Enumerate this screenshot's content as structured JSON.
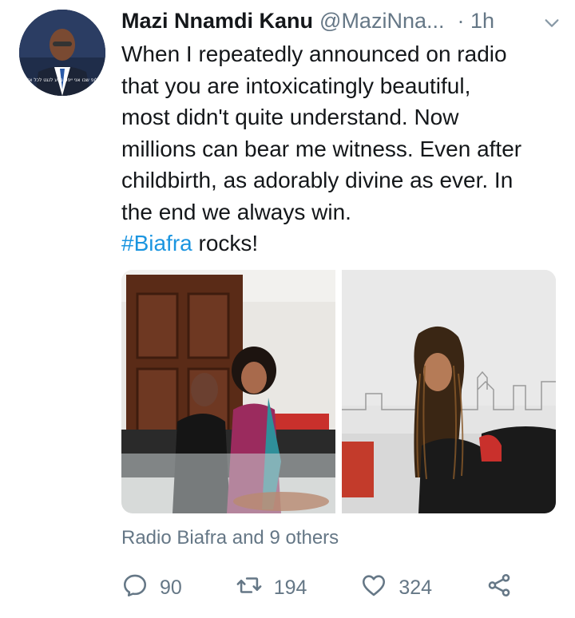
{
  "tweet": {
    "display_name": "Mazi Nnamdi Kanu",
    "handle": "@MaziNna...",
    "dot": "·",
    "time": "1h",
    "text_lines": [
      "When I repeatedly announced on radio",
      "that you are intoxicatingly beautiful,",
      "most didn't quite understand. Now",
      "millions can bear me witness. Even after",
      "childbirth, as adorably divine as ever. In",
      "the end we always win."
    ],
    "hashtag": "#Biafra",
    "hashtag_suffix": " rocks!",
    "likers_text": "Radio Biafra and 9 others",
    "avatar_overlay_text": "קלופ שבו אני ייפט נגוע לנגט לכל אדם",
    "counts": {
      "replies": "90",
      "retweets": "194",
      "likes": "324"
    }
  },
  "icons": {
    "avatar": "user-avatar",
    "chevron": "chevron-down-icon",
    "reply": "reply-icon",
    "retweet": "retweet-icon",
    "like": "heart-icon",
    "share": "share-icon"
  },
  "colors": {
    "text": "#14171a",
    "secondary": "#657786",
    "link": "#1b95e0"
  }
}
